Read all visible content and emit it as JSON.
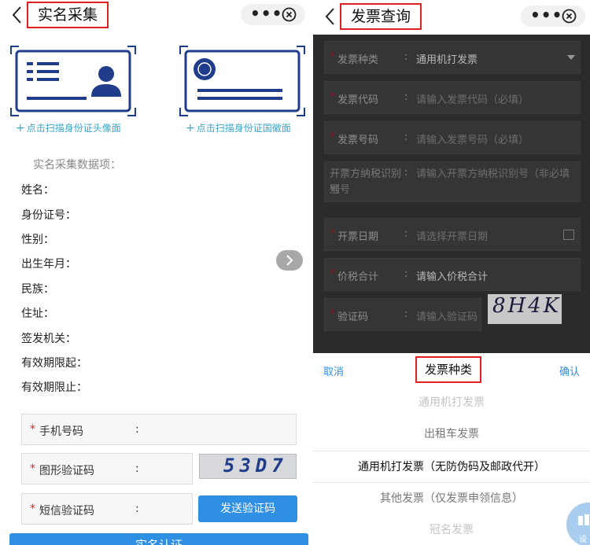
{
  "left": {
    "title": "实名采集",
    "capsule_dots": "•••",
    "id_front_link": "点击扫描身份证头像面",
    "id_back_link": "点击扫描身份证国徽面",
    "plus": "+",
    "info_title": "实名采集数据项：",
    "info_rows": [
      "姓名：",
      "身份证号：",
      "性别：",
      "出生年月：",
      "民族：",
      "住址：",
      "签发机关：",
      "有效期限起：",
      "有效期限止："
    ],
    "form": {
      "star": "*",
      "phone_label": "手机号码",
      "captcha_label": "图形验证码",
      "sms_label": "短信验证码",
      "colon": ":",
      "captcha_text": "53D7",
      "send_button": "发送验证码",
      "submit_button": "实名认证"
    }
  },
  "right": {
    "title": "发票查询",
    "capsule_dots": "•••",
    "fields": {
      "star": "*",
      "colon": ":",
      "type_label": "发票种类",
      "type_value": "通用机打发票",
      "code_label": "发票代码",
      "code_placeholder": "请输入发票代码（必填）",
      "number_label": "发票号码",
      "number_placeholder": "请输入发票号码（必填）",
      "taxid_label": "开票方纳税识别号",
      "taxid_placeholder_a": "请输入开票方纳税识别号（非必填",
      "taxid_placeholder_b": "别号",
      "date_label": "开票日期",
      "date_placeholder": "请选择开票日期",
      "total_label": "价税合计",
      "total_placeholder": "请输入价税合计",
      "verify_label": "验证码",
      "verify_placeholder": "请输入验证码",
      "captcha_text": "8H4K"
    },
    "picker": {
      "cancel": "取消",
      "title": "发票种类",
      "confirm": "确认",
      "options": [
        "通用机打发票",
        "出租车发票",
        "通用机打发票（无防伪码及邮政代开）",
        "其他发票（仅发票申领信息）",
        "冠名发票"
      ],
      "selected_index": 2
    },
    "fab_label": "设"
  },
  "colors": {
    "accent": "#2f8fe3",
    "highlight_border": "#e02020",
    "link": "#3aa6c8",
    "required": "#e02020"
  }
}
